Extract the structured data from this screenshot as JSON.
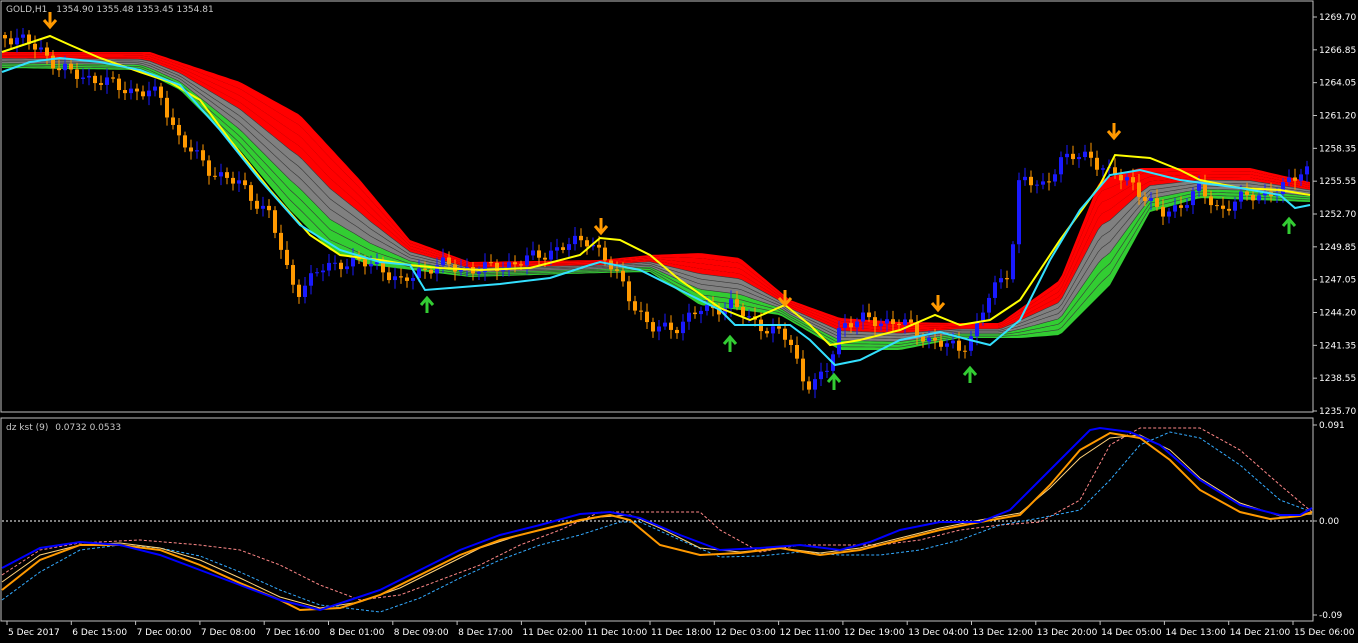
{
  "main_panel": {
    "title": "GOLD,H1",
    "ohlc": "1354.90 1355.48 1353.45 1354.81",
    "price_ticks": [
      "1269.70",
      "1266.85",
      "1264.05",
      "1261.20",
      "1258.35",
      "1255.55",
      "1252.70",
      "1249.85",
      "1247.05",
      "1244.20",
      "1241.35",
      "1238.55",
      "1235.70"
    ]
  },
  "indicator_panel": {
    "title": "dz kst (9)",
    "values": "0.0732 0.0533",
    "ticks": [
      "0.091",
      "0.00",
      "-0.09"
    ]
  },
  "time_ticks": [
    "5 Dec 2017",
    "6 Dec 15:00",
    "7 Dec 00:00",
    "7 Dec 08:00",
    "7 Dec 16:00",
    "8 Dec 01:00",
    "8 Dec 09:00",
    "8 Dec 17:00",
    "11 Dec 02:00",
    "11 Dec 10:00",
    "11 Dec 18:00",
    "12 Dec 03:00",
    "12 Dec 11:00",
    "12 Dec 19:00",
    "13 Dec 04:00",
    "13 Dec 12:00",
    "13 Dec 20:00",
    "14 Dec 05:00",
    "14 Dec 13:00",
    "14 Dec 21:00",
    "15 Dec 06:00"
  ],
  "colors": {
    "background": "#000000",
    "bull_candle": "#1a1aff",
    "bear_candle": "#ff9900",
    "band_red": "#ff0000",
    "band_gray": "#808080",
    "band_green": "#32cd32",
    "line_yellow": "#ffff00",
    "line_cyan": "#33e0ff",
    "arrow_up": "#33cc33",
    "arrow_down": "#ff9900",
    "kst_blue": "#0000ff",
    "kst_orange": "#ff9900",
    "kst_thin": "#ffd27a",
    "kst_cyan_dash": "#33aaff",
    "kst_pink_dash": "#ff8888",
    "axis": "#c0c0c0"
  }
}
